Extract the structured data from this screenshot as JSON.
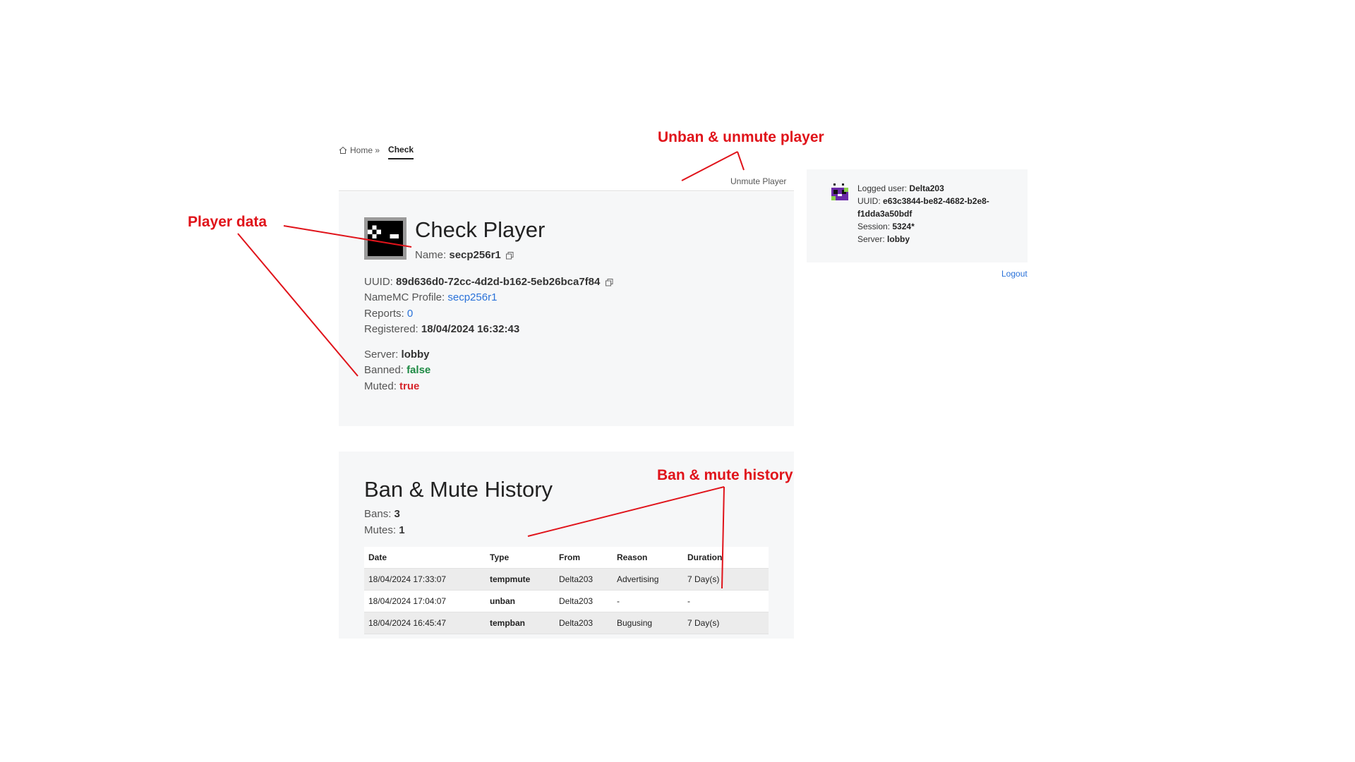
{
  "breadcrumb": {
    "home": "Home »",
    "current": "Check"
  },
  "header": {
    "unmute_label": "Unmute Player"
  },
  "player": {
    "title": "Check Player",
    "name_label": "Name:",
    "name": "secp256r1",
    "uuid_label": "UUID:",
    "uuid": "89d636d0-72cc-4d2d-b162-5eb26bca7f84",
    "namemc_label": "NameMC Profile:",
    "namemc": "secp256r1",
    "reports_label": "Reports:",
    "reports": "0",
    "registered_label": "Registered:",
    "registered": "18/04/2024 16:32:43",
    "server_label": "Server:",
    "server": "lobby",
    "banned_label": "Banned:",
    "banned": "false",
    "muted_label": "Muted:",
    "muted": "true"
  },
  "history": {
    "title": "Ban & Mute History",
    "bans_label": "Bans:",
    "bans": "3",
    "mutes_label": "Mutes:",
    "mutes": "1",
    "columns": [
      "Date",
      "Type",
      "From",
      "Reason",
      "Duration"
    ],
    "rows": [
      {
        "date": "18/04/2024 17:33:07",
        "type": "tempmute",
        "from": "Delta203",
        "reason": "Advertising",
        "duration": "7 Day(s)"
      },
      {
        "date": "18/04/2024 17:04:07",
        "type": "unban",
        "from": "Delta203",
        "reason": "-",
        "duration": "-"
      },
      {
        "date": "18/04/2024 16:45:47",
        "type": "tempban",
        "from": "Delta203",
        "reason": "Bugusing",
        "duration": "7 Day(s)"
      }
    ]
  },
  "session": {
    "logged_label": "Logged user:",
    "logged_user": "Delta203",
    "uuid_label": "UUID:",
    "uuid_line1": "e63c3844-be82-4682-b2e8-",
    "uuid_line2": "f1dda3a50bdf",
    "session_label": "Session:",
    "session": "5324*",
    "server_label": "Server:",
    "server": "lobby",
    "logout": "Logout"
  },
  "annotations": {
    "unban": "Unban & unmute player",
    "player_data": "Player data",
    "history": "Ban & mute history"
  },
  "colors": {
    "annotation": "#e0131a",
    "link": "#2a72d9",
    "banned_false": "#1e8a44",
    "muted_true": "#d6262c",
    "card_bg": "#f6f7f8"
  },
  "icons": [
    "home-icon",
    "copy-icon",
    "player-avatar",
    "user-avatar"
  ]
}
